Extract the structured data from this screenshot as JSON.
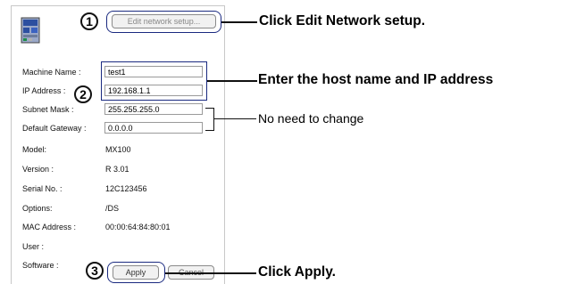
{
  "steps": {
    "step1": "1",
    "step2": "2",
    "step3": "3"
  },
  "toolbar": {
    "edit_network_setup": "Edit network setup..."
  },
  "device": {
    "icon": "network-module-icon"
  },
  "fields": {
    "machine_name": {
      "label": "Machine Name :",
      "value": "test1"
    },
    "ip_address": {
      "label": "IP Address :",
      "value": "192.168.1.1"
    },
    "subnet_mask": {
      "label": "Subnet Mask :",
      "value": "255.255.255.0"
    },
    "default_gateway": {
      "label": "Default Gateway :",
      "value": "0.0.0.0"
    }
  },
  "info": [
    {
      "label": "Model:",
      "value": "MX100"
    },
    {
      "label": "Version :",
      "value": "R 3.01"
    },
    {
      "label": "Serial No. :",
      "value": "12C123456"
    },
    {
      "label": "Options:",
      "value": "/DS"
    },
    {
      "label": "MAC Address :",
      "value": "00:00:64:84:80:01"
    },
    {
      "label": "User :",
      "value": ""
    },
    {
      "label": "Software :",
      "value": ""
    }
  ],
  "buttons": {
    "apply": "Apply",
    "cancel": "Cancel"
  },
  "annotations": {
    "edit": "Click Edit Network setup.",
    "host_ip": "Enter the host name and IP address",
    "no_change": "No need to change",
    "apply": "Click Apply."
  },
  "colors": {
    "highlight": "#1a2a80",
    "device_blue": "#2c4fa0"
  }
}
